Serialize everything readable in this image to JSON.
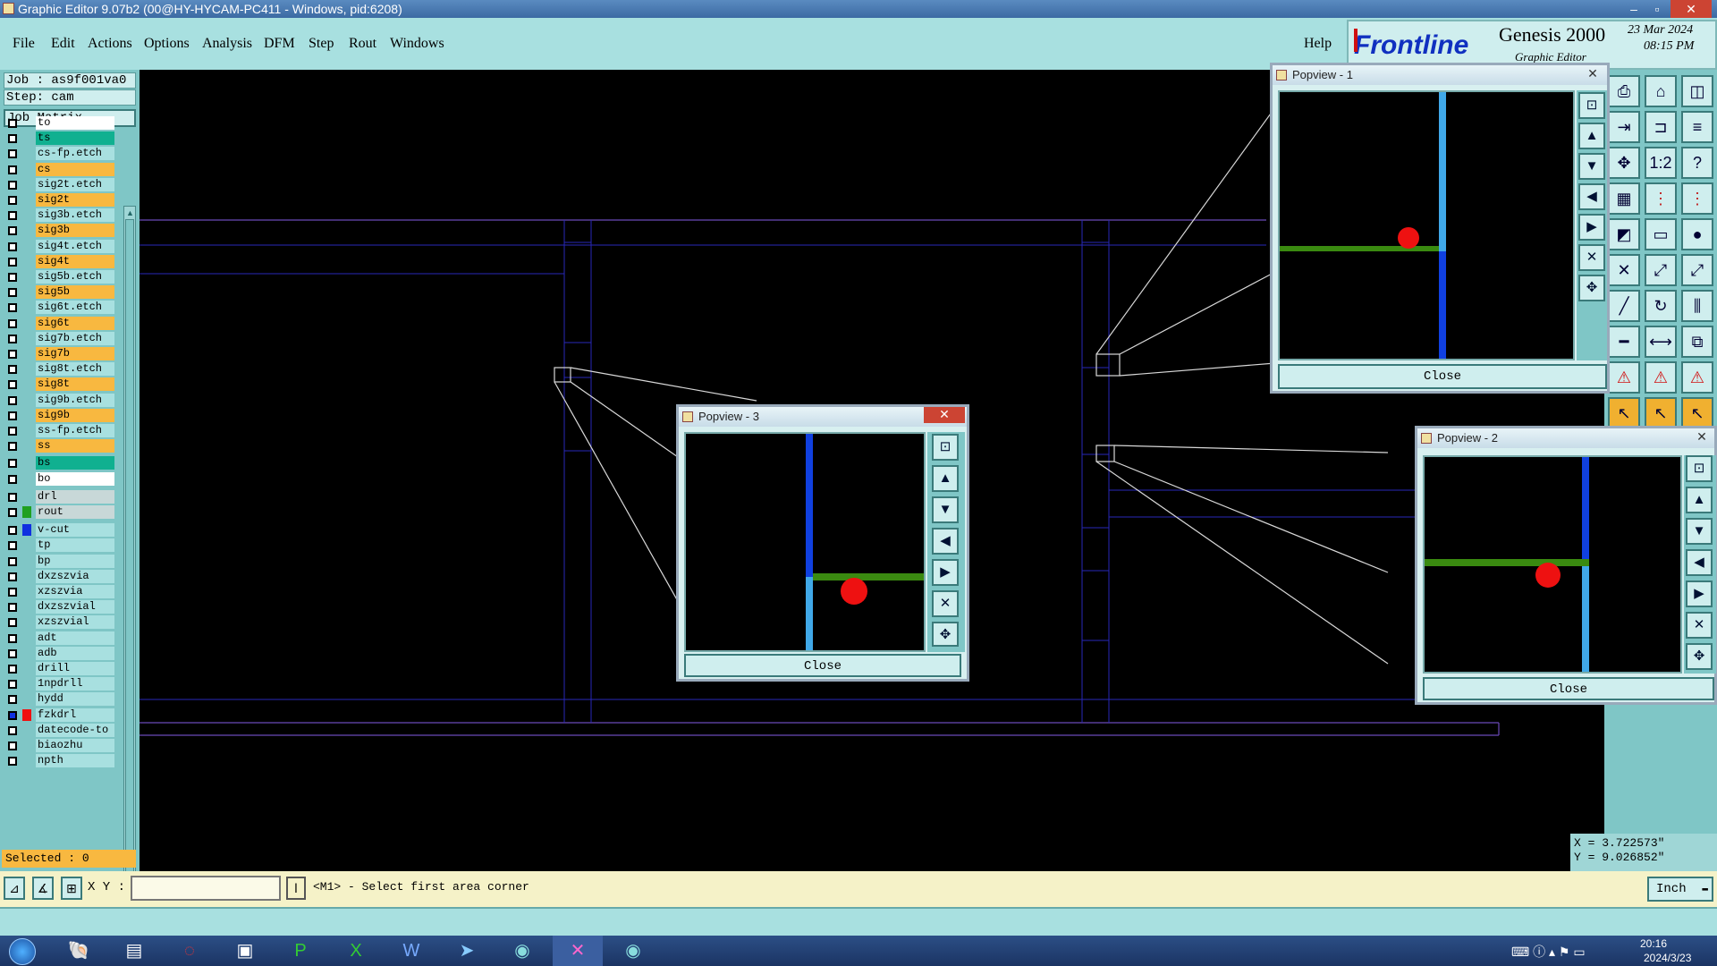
{
  "window": {
    "title": "Graphic Editor 9.07b2 (00@HY-HYCAM-PC411 - Windows, pid:6208)",
    "min": "‒",
    "max": "▫",
    "close": "✕"
  },
  "menu": {
    "items": [
      "File",
      "Edit",
      "Actions",
      "Options",
      "Analysis",
      "DFM",
      "Step",
      "Rout",
      "Windows"
    ],
    "help": "Help"
  },
  "brand": {
    "logo": "Frontline",
    "product": "Genesis 2000",
    "subtitle": "Graphic Editor",
    "date": "23 Mar 2024",
    "time": "08:15 PM"
  },
  "job": {
    "job": "Job : as9f001va0",
    "step": "Step: cam",
    "matrix": "Job Matrix ..."
  },
  "layers": [
    {
      "name": "to",
      "bg": "#ffffff",
      "sw": ""
    },
    {
      "name": "ts",
      "bg": "#10b090",
      "sw": ""
    },
    {
      "name": "cs-fp.etch",
      "bg": "#a8e0e0",
      "sw": ""
    },
    {
      "name": "cs",
      "bg": "#f8b840",
      "sw": ""
    },
    {
      "name": "sig2t.etch",
      "bg": "#a8e0e0",
      "sw": ""
    },
    {
      "name": "sig2t",
      "bg": "#f8b840",
      "sw": ""
    },
    {
      "name": "sig3b.etch",
      "bg": "#a8e0e0",
      "sw": ""
    },
    {
      "name": "sig3b",
      "bg": "#f8b840",
      "sw": ""
    },
    {
      "name": "sig4t.etch",
      "bg": "#a8e0e0",
      "sw": ""
    },
    {
      "name": "sig4t",
      "bg": "#f8b840",
      "sw": ""
    },
    {
      "name": "sig5b.etch",
      "bg": "#a8e0e0",
      "sw": ""
    },
    {
      "name": "sig5b",
      "bg": "#f8b840",
      "sw": ""
    },
    {
      "name": "sig6t.etch",
      "bg": "#a8e0e0",
      "sw": ""
    },
    {
      "name": "sig6t",
      "bg": "#f8b840",
      "sw": ""
    },
    {
      "name": "sig7b.etch",
      "bg": "#a8e0e0",
      "sw": ""
    },
    {
      "name": "sig7b",
      "bg": "#f8b840",
      "sw": ""
    },
    {
      "name": "sig8t.etch",
      "bg": "#a8e0e0",
      "sw": ""
    },
    {
      "name": "sig8t",
      "bg": "#f8b840",
      "sw": ""
    },
    {
      "name": "sig9b.etch",
      "bg": "#a8e0e0",
      "sw": ""
    },
    {
      "name": "sig9b",
      "bg": "#f8b840",
      "sw": ""
    },
    {
      "name": "ss-fp.etch",
      "bg": "#a8e0e0",
      "sw": ""
    },
    {
      "name": "ss",
      "bg": "#f8b840",
      "sw": ""
    },
    {
      "name": "bs",
      "bg": "#10b090",
      "sw": ""
    },
    {
      "name": "bo",
      "bg": "#ffffff",
      "sw": ""
    },
    {
      "name": "drl",
      "bg": "#c8d8d8",
      "sw": ""
    },
    {
      "name": "rout",
      "bg": "#c8d8d8",
      "sw": "#20a020"
    },
    {
      "name": "v-cut",
      "bg": "#a8e0e0",
      "sw": "#1030e0"
    },
    {
      "name": "tp",
      "bg": "#a8e0e0",
      "sw": ""
    },
    {
      "name": "bp",
      "bg": "#a8e0e0",
      "sw": ""
    },
    {
      "name": "dxzszvia",
      "bg": "#a8e0e0",
      "sw": ""
    },
    {
      "name": "xzszvia",
      "bg": "#a8e0e0",
      "sw": ""
    },
    {
      "name": "dxzszvial",
      "bg": "#a8e0e0",
      "sw": ""
    },
    {
      "name": "xzszvial",
      "bg": "#a8e0e0",
      "sw": ""
    },
    {
      "name": "adt",
      "bg": "#a8e0e0",
      "sw": ""
    },
    {
      "name": "adb",
      "bg": "#a8e0e0",
      "sw": ""
    },
    {
      "name": "drill",
      "bg": "#a8e0e0",
      "sw": ""
    },
    {
      "name": "1npdrll",
      "bg": "#a8e0e0",
      "sw": ""
    },
    {
      "name": "hydd",
      "bg": "#a8e0e0",
      "sw": ""
    },
    {
      "name": "fzkdrl",
      "bg": "#a8e0e0",
      "sw": "#f01010"
    },
    {
      "name": "datecode-to",
      "bg": "#a8e0e0",
      "sw": ""
    },
    {
      "name": "biaozhu",
      "bg": "#a8e0e0",
      "sw": ""
    },
    {
      "name": "npth",
      "bg": "#a8e0e0",
      "sw": ""
    }
  ],
  "selected": "Selected : 0",
  "popviews": {
    "p1": {
      "title": "Popview - 1",
      "close": "Close"
    },
    "p2": {
      "title": "Popview - 2",
      "close": "Close"
    },
    "p3": {
      "title": "Popview - 3",
      "close": "Close"
    }
  },
  "coords": {
    "x": "X = 3.722573\"",
    "y": "Y = 9.026852\""
  },
  "status": {
    "xy_label": "X Y :",
    "xy_value": "",
    "prompt": "<M1> - Select first area corner",
    "units": "Inch"
  },
  "clock": {
    "time": "20:16",
    "date": "2024/3/23"
  }
}
